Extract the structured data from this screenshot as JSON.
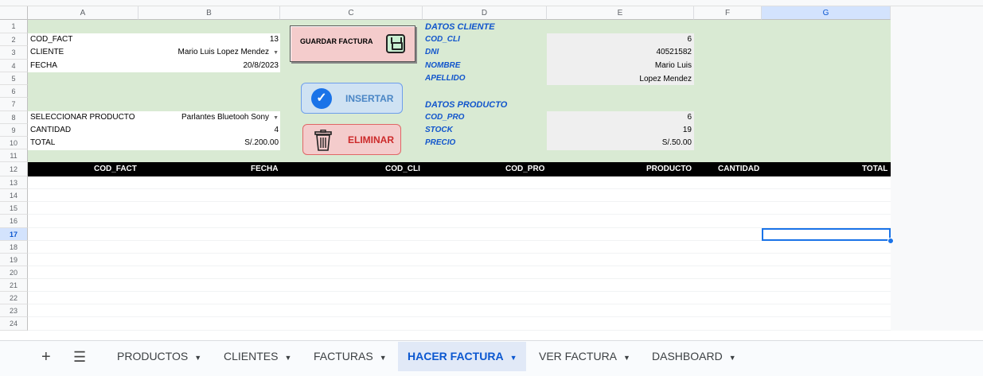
{
  "columns": [
    "A",
    "B",
    "C",
    "D",
    "E",
    "F",
    "G"
  ],
  "rows": [
    "1",
    "2",
    "3",
    "4",
    "5",
    "6",
    "7",
    "8",
    "9",
    "10",
    "11",
    "12",
    "13",
    "14",
    "15",
    "16",
    "17",
    "18",
    "19",
    "20",
    "21",
    "22",
    "23",
    "24"
  ],
  "selected_column": "G",
  "selected_row": "17",
  "invoice_form": {
    "cod_fact_label": "COD_FACT",
    "cod_fact_value": "13",
    "cliente_label": "CLIENTE",
    "cliente_value": "Mario Luis Lopez Mendez",
    "fecha_label": "FECHA",
    "fecha_value": "20/8/2023",
    "producto_label": "SELECCIONAR PRODUCTO",
    "producto_value": "Parlantes Bluetooh Sony",
    "cantidad_label": "CANTIDAD",
    "cantidad_value": "4",
    "total_label": "TOTAL",
    "total_value": "S/.200.00"
  },
  "buttons": {
    "guardar": "GUARDAR FACTURA",
    "insertar": "INSERTAR",
    "eliminar": "ELIMINAR"
  },
  "datos_cliente": {
    "heading": "DATOS CLIENTE",
    "cod_cli_label": "COD_CLI",
    "cod_cli_value": "6",
    "dni_label": "DNI",
    "dni_value": "40521582",
    "nombre_label": "NOMBRE",
    "nombre_value": "Mario Luis",
    "apellido_label": "APELLIDO",
    "apellido_value": "Lopez Mendez"
  },
  "datos_producto": {
    "heading": "DATOS PRODUCTO",
    "cod_pro_label": "COD_PRO",
    "cod_pro_value": "6",
    "stock_label": "STOCK",
    "stock_value": "19",
    "precio_label": "PRECIO",
    "precio_value": "S/.50.00"
  },
  "detail_headers": [
    "COD_FACT",
    "FECHA",
    "COD_CLI",
    "COD_PRO",
    "PRODUCTO",
    "CANTIDAD",
    "TOTAL"
  ],
  "sheet_tabs": [
    "PRODUCTOS",
    "CLIENTES",
    "FACTURAS",
    "HACER FACTURA",
    "VER FACTURA",
    "DASHBOARD"
  ],
  "active_tab": "HACER FACTURA",
  "colors": {
    "form_bg": "#d9ead3",
    "accent": "#1a73e8",
    "label_blue": "#1155cc"
  }
}
